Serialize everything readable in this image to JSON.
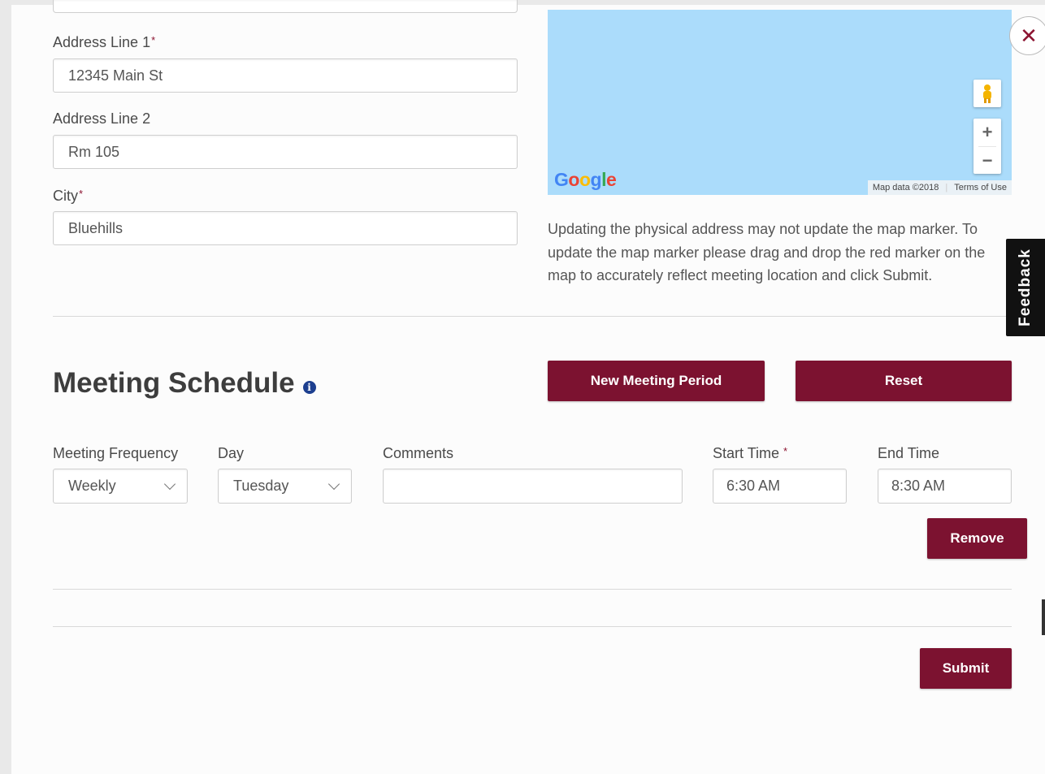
{
  "address": {
    "line1_label": "Address Line 1",
    "line1_value": "12345 Main St",
    "line2_label": "Address Line 2",
    "line2_value": "Rm 105",
    "city_label": "City",
    "city_value": "Bluehills",
    "required_mark": "*"
  },
  "map": {
    "logo": "Google",
    "map_data": "Map data ©2018",
    "terms": "Terms of Use",
    "zoom_in": "+",
    "zoom_out": "−",
    "water_color": "#abdcfb"
  },
  "map_note": "Updating the physical address may not update the map marker. To update the map marker please drag and drop the red marker on the map to accurately reflect meeting location and click Submit.",
  "schedule": {
    "title": "Meeting Schedule",
    "new_period_label": "New Meeting Period",
    "reset_label": "Reset",
    "frequency_label": "Meeting Frequency",
    "frequency_value": "Weekly",
    "day_label": "Day",
    "day_value": "Tuesday",
    "comments_label": "Comments",
    "comments_value": "",
    "start_label": "Start Time",
    "start_value": "6:30 AM",
    "end_label": "End Time",
    "end_value": "8:30 AM",
    "remove_label": "Remove"
  },
  "submit_label": "Submit",
  "feedback_label": "Feedback",
  "close_glyph": "✕",
  "info_glyph": "i",
  "accent_color": "#7c1230"
}
